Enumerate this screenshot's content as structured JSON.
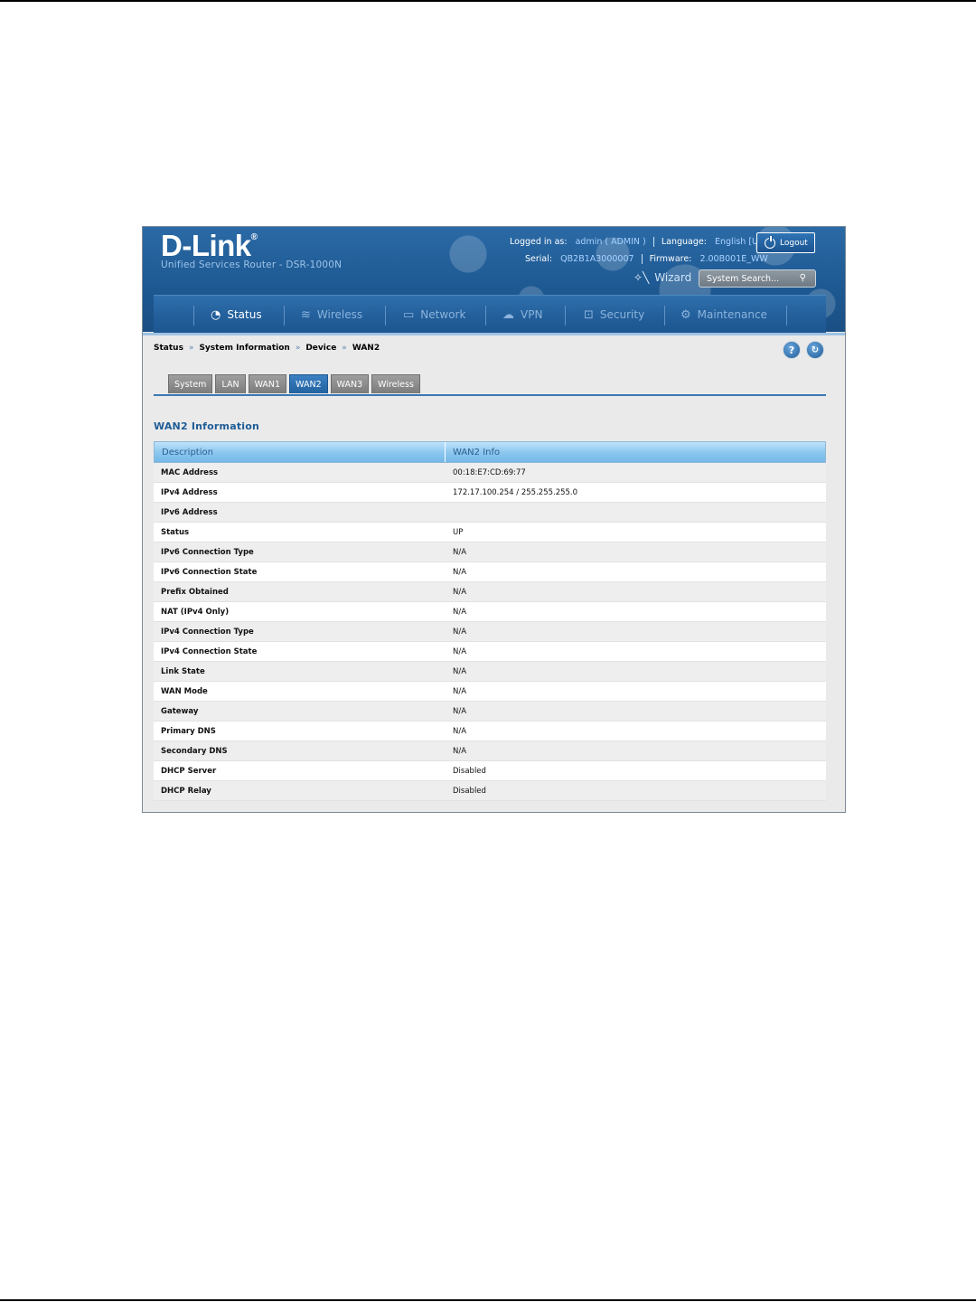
{
  "header": {
    "logo": "D-Link",
    "logo_mark": "®",
    "subtitle": "Unified Services Router - DSR-1000N",
    "logged_in_label": "Logged in as:",
    "logged_in_value": "admin ( ADMIN )",
    "language_label": "Language:",
    "language_value": "English [US]",
    "logout_label": "Logout",
    "serial_label": "Serial:",
    "serial_value": "QB2B1A3000007",
    "firmware_label": "Firmware:",
    "firmware_value": "2.00B001E_WW",
    "wizard_label": "Wizard",
    "search_placeholder": "System Search..."
  },
  "nav": {
    "items": [
      {
        "label": "Status",
        "icon": "gauge-icon"
      },
      {
        "label": "Wireless",
        "icon": "wifi-icon"
      },
      {
        "label": "Network",
        "icon": "monitor-icon"
      },
      {
        "label": "VPN",
        "icon": "cloud-lock-icon"
      },
      {
        "label": "Security",
        "icon": "lock-icon"
      },
      {
        "label": "Maintenance",
        "icon": "gears-icon"
      }
    ]
  },
  "breadcrumb": {
    "items": [
      "Status",
      "System Information",
      "Device",
      "WAN2"
    ],
    "separator": "»"
  },
  "tabs": [
    {
      "label": "System",
      "active": false
    },
    {
      "label": "LAN",
      "active": false
    },
    {
      "label": "WAN1",
      "active": false
    },
    {
      "label": "WAN2",
      "active": true
    },
    {
      "label": "WAN3",
      "active": false
    },
    {
      "label": "Wireless",
      "active": false
    }
  ],
  "section_title": "WAN2 Information",
  "table": {
    "headers": [
      "Description",
      "WAN2 Info"
    ],
    "rows": [
      [
        "MAC Address",
        "00:18:E7:CD:69:77"
      ],
      [
        "IPv4 Address",
        "172.17.100.254 / 255.255.255.0"
      ],
      [
        "IPv6 Address",
        ""
      ],
      [
        "Status",
        "UP"
      ],
      [
        "IPv6 Connection Type",
        "N/A"
      ],
      [
        "IPv6 Connection State",
        "N/A"
      ],
      [
        "Prefix Obtained",
        "N/A"
      ],
      [
        "NAT (IPv4 Only)",
        "N/A"
      ],
      [
        "IPv4 Connection Type",
        "N/A"
      ],
      [
        "IPv4 Connection State",
        "N/A"
      ],
      [
        "Link State",
        "N/A"
      ],
      [
        "WAN Mode",
        "N/A"
      ],
      [
        "Gateway",
        "N/A"
      ],
      [
        "Primary DNS",
        "N/A"
      ],
      [
        "Secondary DNS",
        "N/A"
      ],
      [
        "DHCP Server",
        "Disabled"
      ],
      [
        "DHCP Relay",
        "Disabled"
      ]
    ]
  },
  "colors": {
    "header_blue": "#1d5891",
    "link_blue": "#a9d2ff",
    "active_tab": "#22629f",
    "table_header": "#8dc8f0"
  }
}
